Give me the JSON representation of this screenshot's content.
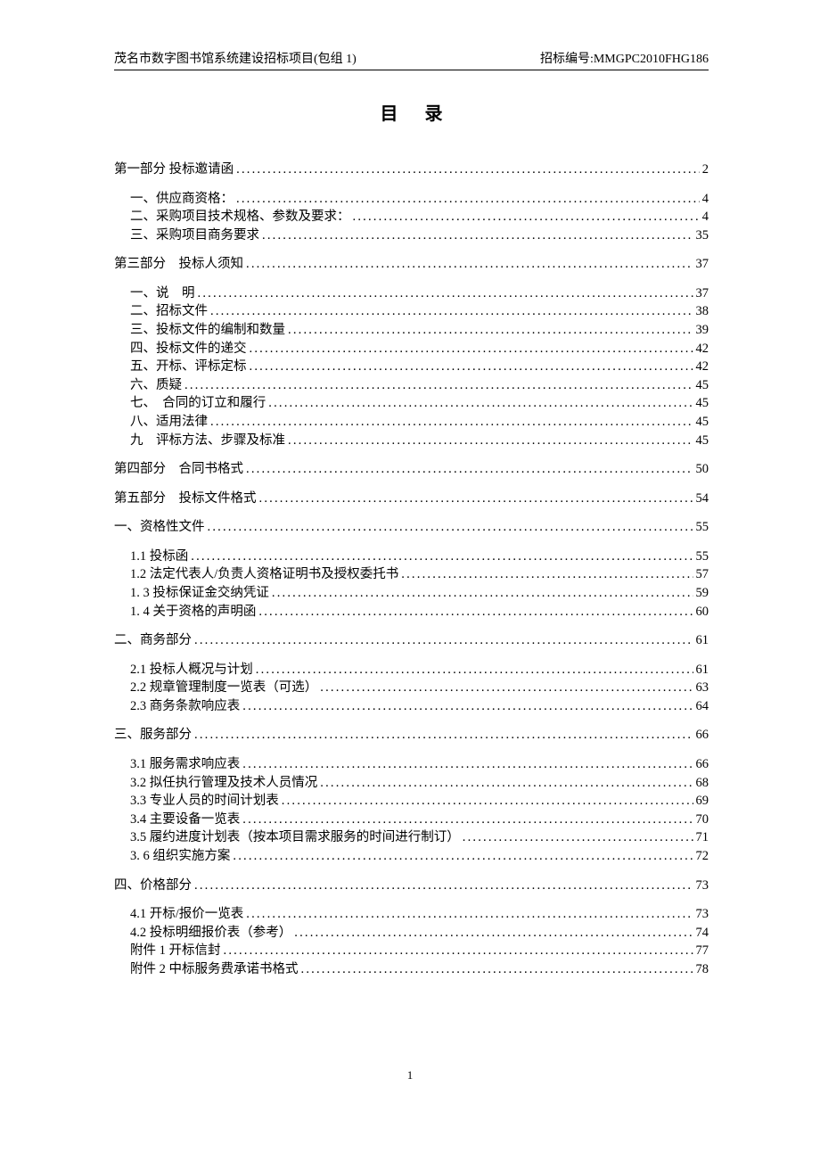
{
  "header": {
    "left": "茂名市数字图书馆系统建设招标项目(包组 1)",
    "right": "招标编号:MMGPC2010FHG186"
  },
  "title": "目录",
  "toc": [
    {
      "type": "group",
      "items": [
        {
          "level": 1,
          "label": "第一部分 投标邀请函",
          "page": "2"
        }
      ]
    },
    {
      "type": "group",
      "items": [
        {
          "level": 2,
          "label": "一、供应商资格：",
          "page": "4"
        },
        {
          "level": 2,
          "label": "二、采购项目技术规格、参数及要求：",
          "page": "4"
        },
        {
          "level": 2,
          "label": "三、采购项目商务要求",
          "page": "35"
        }
      ]
    },
    {
      "type": "group",
      "items": [
        {
          "level": 1,
          "label": "第三部分　投标人须知",
          "page": "37"
        }
      ]
    },
    {
      "type": "group",
      "items": [
        {
          "level": 2,
          "label": "一、说　明",
          "page": "37"
        },
        {
          "level": 2,
          "label": "二、招标文件",
          "page": "38"
        },
        {
          "level": 2,
          "label": "三、投标文件的编制和数量",
          "page": "39"
        },
        {
          "level": 2,
          "label": "四、投标文件的递交",
          "page": "42"
        },
        {
          "level": 2,
          "label": "五、开标、评标定标",
          "page": "42"
        },
        {
          "level": 2,
          "label": "六、质疑",
          "page": "45"
        },
        {
          "level": 2,
          "label": "七、　合同的订立和履行",
          "page": "45"
        },
        {
          "level": 2,
          "label": "八、适用法律",
          "page": "45"
        },
        {
          "level": 2,
          "label": "九　评标方法、步骤及标准",
          "page": "45"
        }
      ]
    },
    {
      "type": "group",
      "items": [
        {
          "level": 1,
          "label": "第四部分　合同书格式",
          "page": "50"
        }
      ]
    },
    {
      "type": "group",
      "items": [
        {
          "level": 1,
          "label": "第五部分　投标文件格式",
          "page": "54"
        }
      ]
    },
    {
      "type": "group",
      "items": [
        {
          "level": 1,
          "label": "一、资格性文件",
          "page": "55"
        }
      ]
    },
    {
      "type": "group",
      "items": [
        {
          "level": 2,
          "label": "1.1 投标函",
          "page": "55"
        },
        {
          "level": 2,
          "label": "1.2 法定代表人/负责人资格证明书及授权委托书",
          "page": "57"
        },
        {
          "level": 2,
          "label": "1. 3 投标保证金交纳凭证",
          "page": "59"
        },
        {
          "level": 2,
          "label": "1. 4 关于资格的声明函",
          "page": "60"
        }
      ]
    },
    {
      "type": "group",
      "items": [
        {
          "level": 1,
          "label": "二、商务部分",
          "page": "61"
        }
      ]
    },
    {
      "type": "group",
      "items": [
        {
          "level": 2,
          "label": "2.1 投标人概况与计划",
          "page": "61"
        },
        {
          "level": 2,
          "label": "2.2 规章管理制度一览表（可选）",
          "page": "63"
        },
        {
          "level": 2,
          "label": "2.3 商务条款响应表",
          "page": "64"
        }
      ]
    },
    {
      "type": "group",
      "items": [
        {
          "level": 1,
          "label": "三、服务部分",
          "page": "66"
        }
      ]
    },
    {
      "type": "group",
      "items": [
        {
          "level": 2,
          "label": "3.1 服务需求响应表",
          "page": "66"
        },
        {
          "level": 2,
          "label": "3.2 拟任执行管理及技术人员情况",
          "page": "68"
        },
        {
          "level": 2,
          "label": "3.3 专业人员的时间计划表",
          "page": "69"
        },
        {
          "level": 2,
          "label": "3.4 主要设备一览表",
          "page": "70"
        },
        {
          "level": 2,
          "label": "3.5 履约进度计划表（按本项目需求服务的时间进行制订）",
          "page": "71"
        },
        {
          "level": 2,
          "label": "3. 6  组织实施方案",
          "page": "72"
        }
      ]
    },
    {
      "type": "group",
      "items": [
        {
          "level": 1,
          "label": "四、价格部分",
          "page": "73"
        }
      ]
    },
    {
      "type": "group",
      "items": [
        {
          "level": 2,
          "label": "4.1 开标/报价一览表",
          "page": "73"
        },
        {
          "level": 2,
          "label": "4.2 投标明细报价表（参考）",
          "page": "74"
        },
        {
          "level": 2,
          "label": "附件 1  开标信封",
          "page": "77"
        },
        {
          "level": 2,
          "label": "附件 2 中标服务费承诺书格式",
          "page": "78"
        }
      ]
    }
  ],
  "page_number": "1"
}
